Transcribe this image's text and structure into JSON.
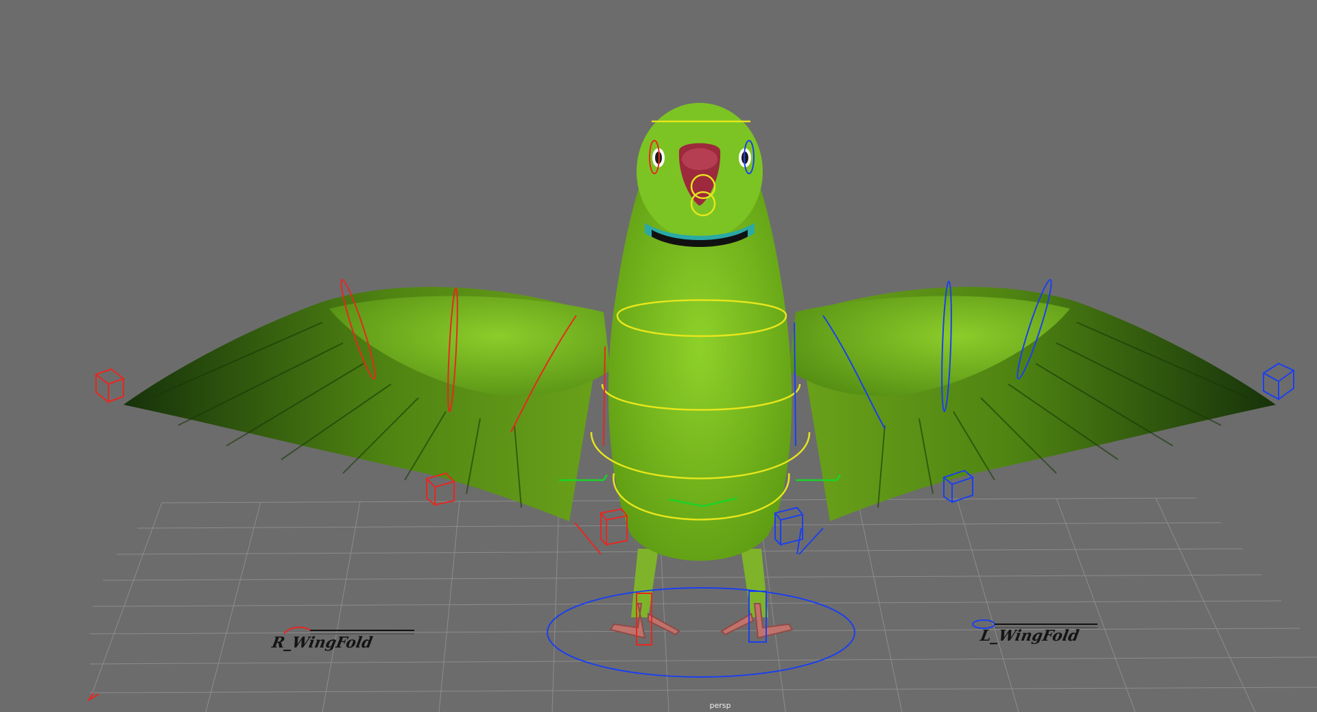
{
  "viewport": {
    "camera_label": "persp",
    "background_color": "#6c6c6c",
    "grid_color": "#8d8d8d",
    "body_color": "#7fc41f",
    "right_side_color": "#e8271f",
    "left_side_color": "#1a3ff0",
    "center_color": "#e6e61c",
    "fk_color": "#19d327"
  },
  "switches": {
    "right_label": "R_WingFold",
    "left_label": "L_WingFold"
  }
}
